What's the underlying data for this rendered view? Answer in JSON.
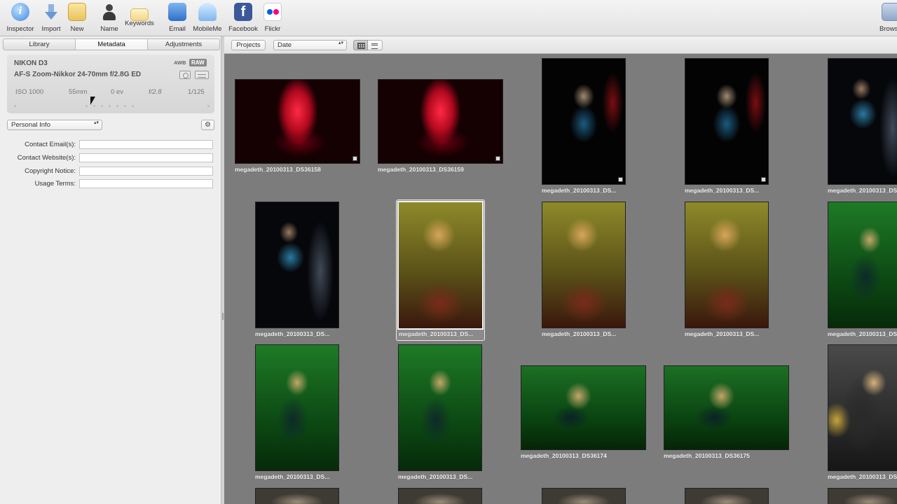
{
  "toolbar": {
    "buttons": [
      {
        "label": "Inspector",
        "icon": "info-icon"
      },
      {
        "label": "Import",
        "icon": "import-arrow-icon"
      },
      {
        "label": "New",
        "icon": "new-project-icon"
      },
      {
        "label": "Name",
        "icon": "person-silhouette-icon"
      },
      {
        "label": "Keywords",
        "icon": "keyword-tag-icon"
      },
      {
        "label": "Email",
        "icon": "email-icon"
      },
      {
        "label": "MobileMe",
        "icon": "mobileme-cloud-icon"
      },
      {
        "label": "Facebook",
        "icon": "facebook-icon"
      },
      {
        "label": "Flickr",
        "icon": "flickr-icon"
      },
      {
        "label": "Brows",
        "icon": "browser-grid-icon"
      }
    ]
  },
  "inspector": {
    "tabs": [
      "Library",
      "Metadata",
      "Adjustments"
    ],
    "active_tab": "Metadata",
    "camera": {
      "model": "NIKON D3",
      "lens": "AF-S Zoom-Nikkor 24-70mm f/2.8G ED",
      "badge_awb": "AWB",
      "badge_raw": "RAW",
      "iso": "ISO 1000",
      "focal": "55mm",
      "ev": "0 ev",
      "aperture": "f/2.8",
      "shutter": "1/125"
    },
    "preset": {
      "value": "Personal Info",
      "arrows": "▴▾"
    },
    "gear_icon": "⚙",
    "fields": [
      {
        "label": "Contact Email(s):",
        "value": ""
      },
      {
        "label": "Contact Website(s):",
        "value": ""
      },
      {
        "label": "Copyright Notice:",
        "value": ""
      },
      {
        "label": "Usage Terms:",
        "value": ""
      }
    ]
  },
  "browser": {
    "projects_label": "Projects",
    "sort": {
      "value": "Date",
      "arrows": "▴▾"
    }
  },
  "photos": [
    {
      "label": "megadeth_20100313_DS36158",
      "style": "red"
    },
    {
      "label": "megadeth_20100313_DS36159",
      "style": "red"
    },
    {
      "label": "megadeth_20100313_DS...",
      "style": "stage"
    },
    {
      "label": "megadeth_20100313_DS...",
      "style": "stage"
    },
    {
      "label": "megadeth_20100313_DS...",
      "style": "dark"
    },
    {
      "label": "megadeth_20100313_DS...",
      "style": "dark"
    },
    {
      "label": "megadeth_20100313_DS...",
      "style": "yellow",
      "selected": true
    },
    {
      "label": "megadeth_20100313_DS...",
      "style": "yellow"
    },
    {
      "label": "megadeth_20100313_DS...",
      "style": "yellow"
    },
    {
      "label": "megadeth_20100313_DS...",
      "style": "green"
    },
    {
      "label": "megadeth_20100313_DS...",
      "style": "green"
    },
    {
      "label": "megadeth_20100313_DS...",
      "style": "green"
    },
    {
      "label": "megadeth_20100313_DS36174",
      "style": "greenwide"
    },
    {
      "label": "megadeth_20100313_DS36175",
      "style": "greenwide"
    },
    {
      "label": "megadeth_20100313_DS...",
      "style": "live"
    }
  ]
}
